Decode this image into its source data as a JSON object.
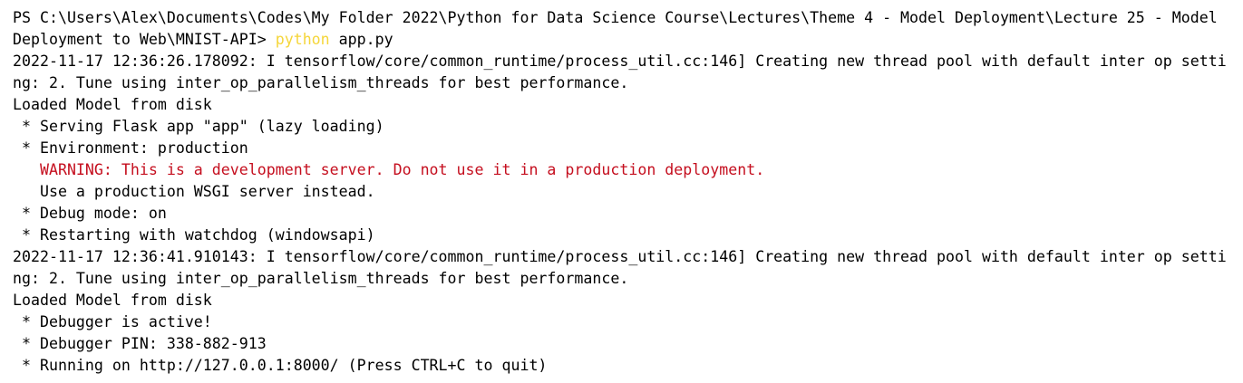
{
  "terminal": {
    "prompt_line1": "PS C:\\Users\\Alex\\Documents\\Codes\\My Folder 2022\\Python for Data Science Course\\Lectures\\Theme 4 - Model Deployment\\Lecture 25 - Model",
    "prompt_line2_path": "Deployment to Web\\MNIST-API> ",
    "command_name": "python",
    "command_args": " app.py",
    "lines": [
      "2022-11-17 12:36:26.178092: I tensorflow/core/common_runtime/process_util.cc:146] Creating new thread pool with default inter op setti",
      "ng: 2. Tune using inter_op_parallelism_threads for best performance.",
      "Loaded Model from disk",
      " * Serving Flask app \"app\" (lazy loading)",
      " * Environment: production"
    ],
    "warning_line": "   WARNING: This is a development server. Do not use it in a production deployment.",
    "lines_after_warning": [
      "   Use a production WSGI server instead.",
      " * Debug mode: on",
      " * Restarting with watchdog (windowsapi)",
      "2022-11-17 12:36:41.910143: I tensorflow/core/common_runtime/process_util.cc:146] Creating new thread pool with default inter op setti",
      "ng: 2. Tune using inter_op_parallelism_threads for best performance.",
      "Loaded Model from disk",
      " * Debugger is active!",
      " * Debugger PIN: 338-882-913",
      " * Running on http://127.0.0.1:8000/ (Press CTRL+C to quit)"
    ],
    "colors": {
      "background": "#ffffff",
      "text": "#000000",
      "command": "#f5d63a",
      "warning": "#c50f1f"
    }
  }
}
